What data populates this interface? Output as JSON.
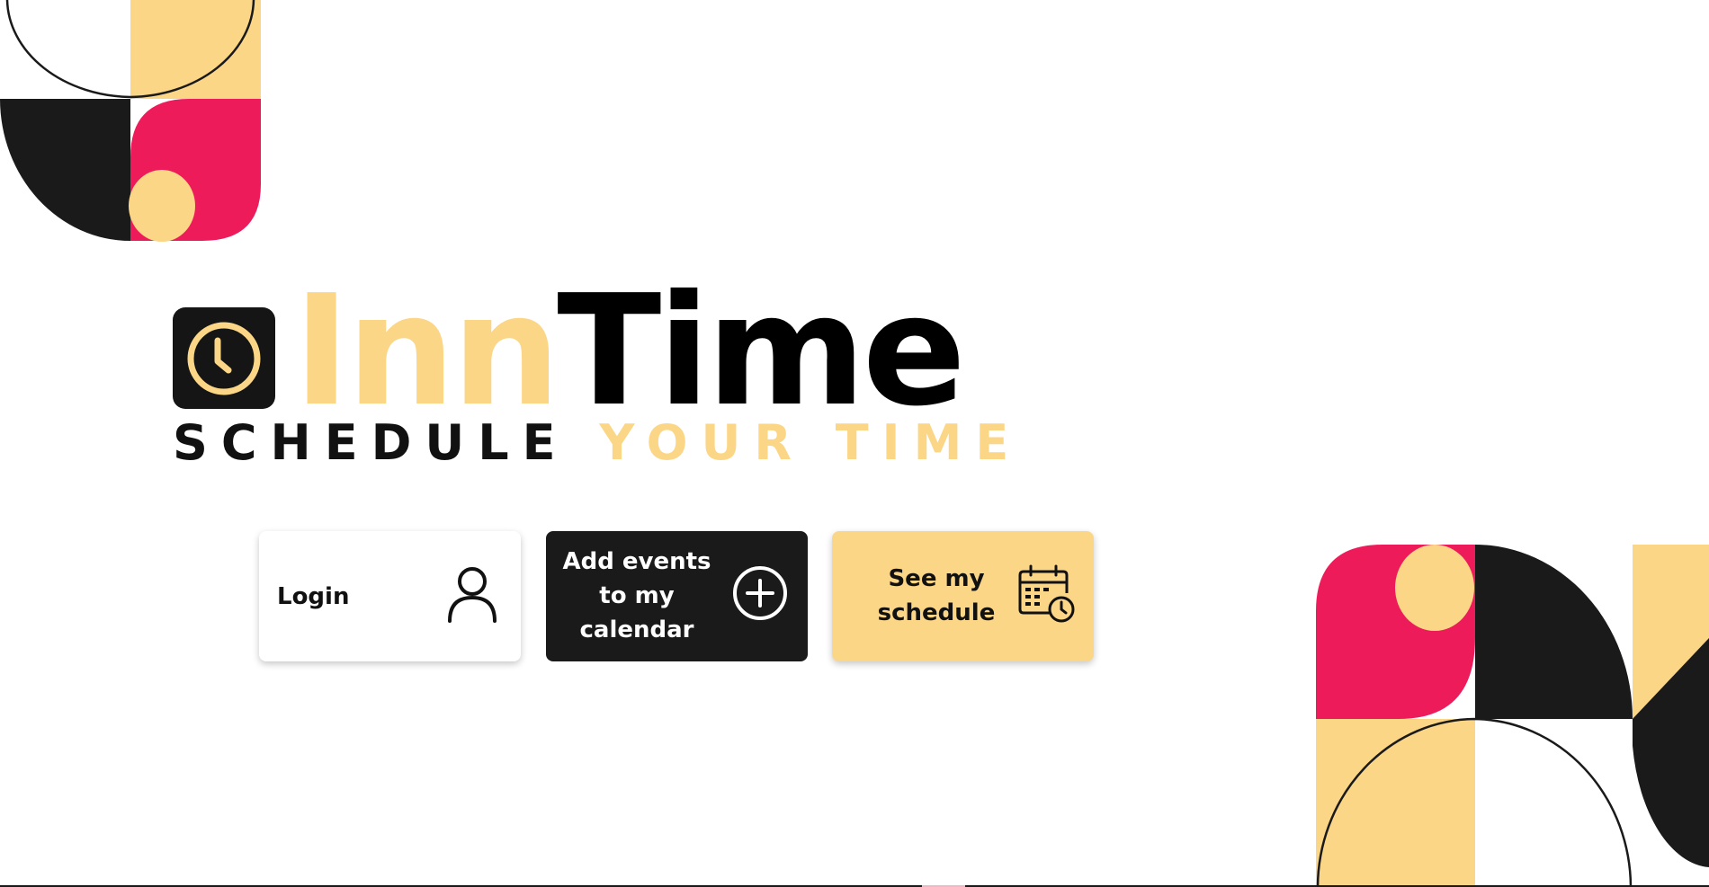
{
  "brand": {
    "title_part1": "Inn",
    "title_part2": "Time",
    "tagline_part1": "SCHEDULE",
    "tagline_part2": "YOUR TIME",
    "logo_icon": "clock-icon"
  },
  "actions": {
    "login_label": "Login",
    "login_icon": "user-icon",
    "add_events_label": "Add events to my calendar",
    "add_events_icon": "plus-circle-icon",
    "schedule_label": "See my schedule",
    "schedule_icon": "calendar-clock-icon"
  },
  "colors": {
    "yellow": "#fbd686",
    "pink": "#ee1b5a",
    "black": "#1a1a1a",
    "white": "#ffffff"
  }
}
